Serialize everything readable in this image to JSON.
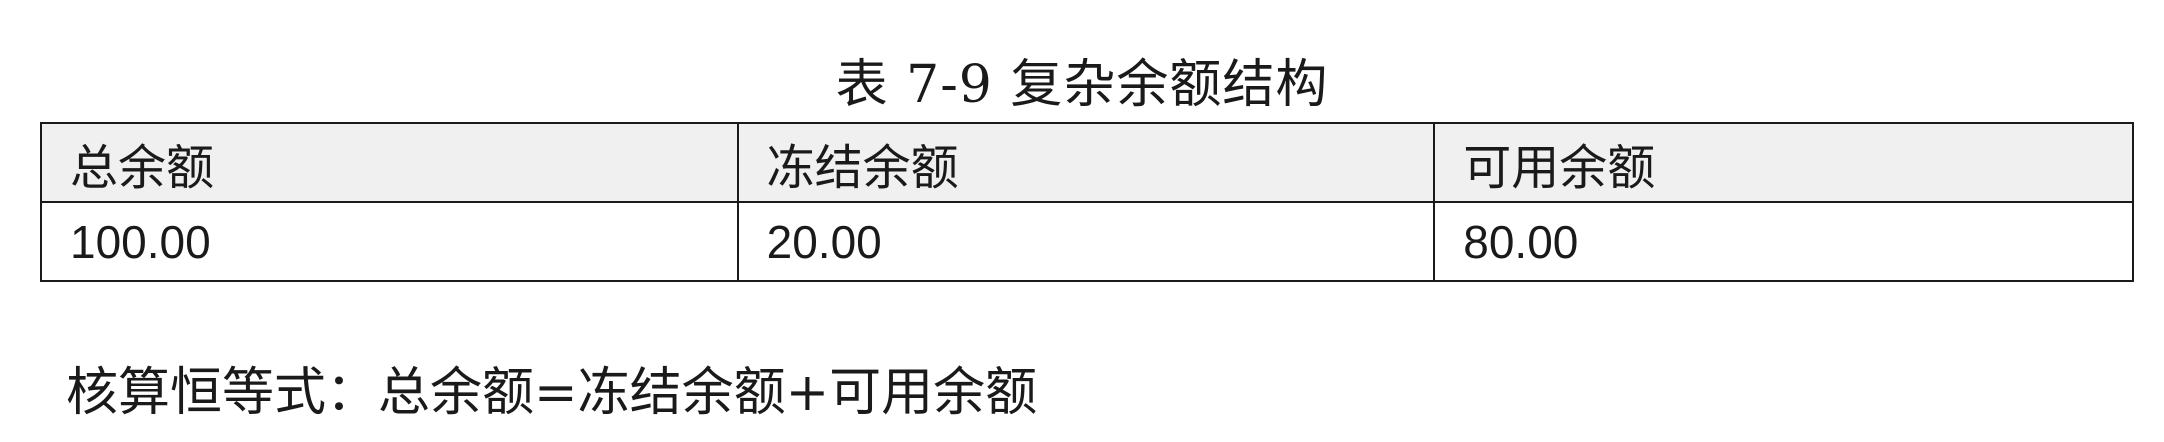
{
  "caption": "表 7-9 复杂余额结构",
  "table": {
    "headers": [
      "总余额",
      "冻结余额",
      "可用余额"
    ],
    "rows": [
      [
        "100.00",
        "20.00",
        "80.00"
      ]
    ]
  },
  "formula": "核算恒等式：总余额=冻结余额+可用余额"
}
